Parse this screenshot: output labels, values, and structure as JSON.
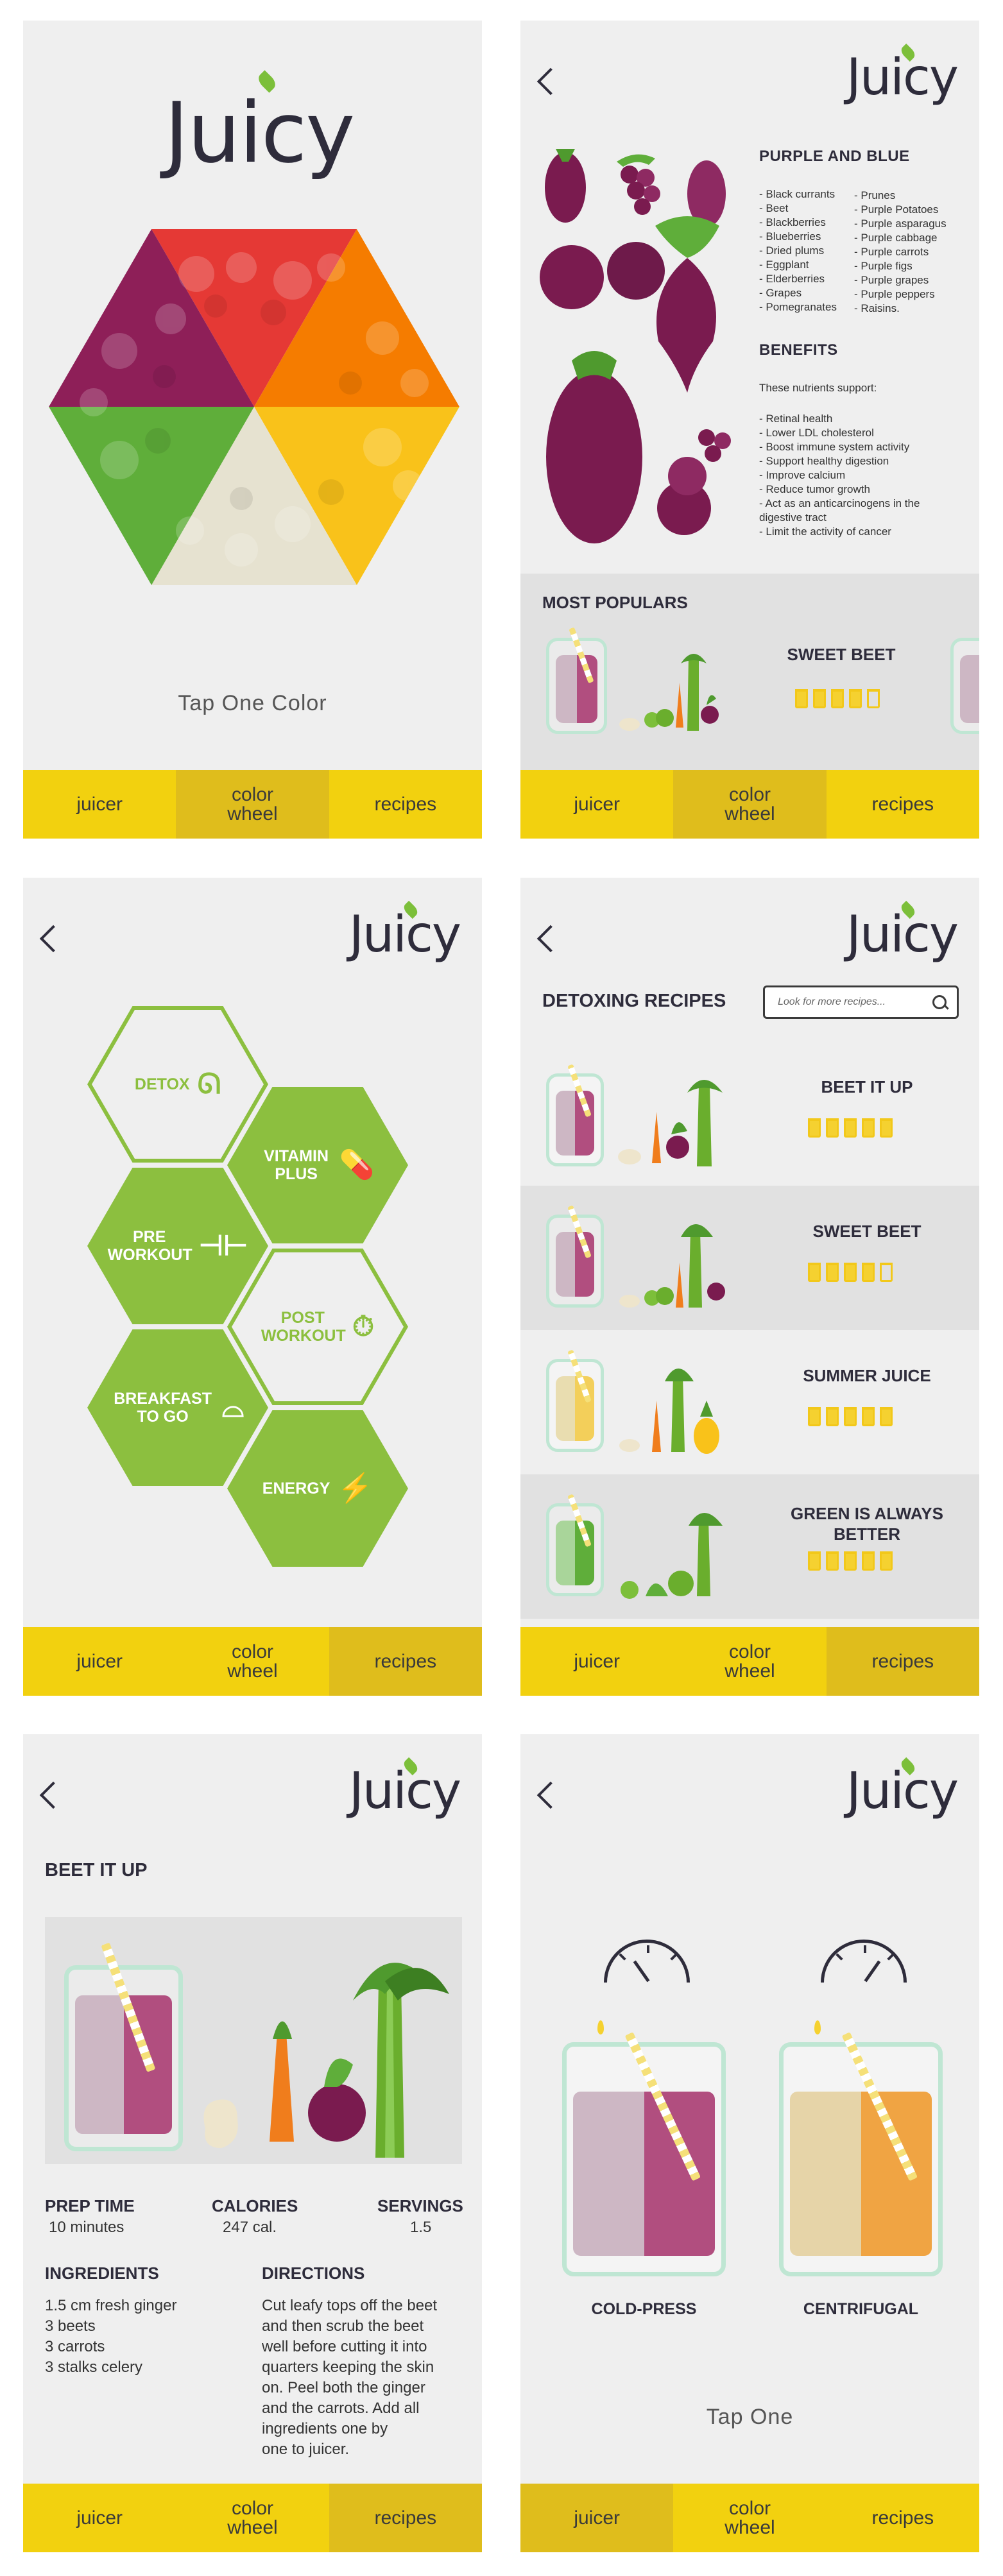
{
  "brand": {
    "logo_text": "Juicy"
  },
  "nav": {
    "juicer": "juicer",
    "color_wheel": "color\nwheel",
    "recipes": "recipes"
  },
  "screen1": {
    "tap_text": "Tap One Color"
  },
  "screen2": {
    "category_title": "PURPLE AND BLUE",
    "foods_col1": [
      "- Black currants",
      "- Beet",
      "- Blackberries",
      "- Blueberries",
      "- Dried plums",
      "- Eggplant",
      "- Elderberries",
      "- Grapes",
      "- Pomegranates"
    ],
    "foods_col2": [
      "- Prunes",
      "- Purple Potatoes",
      "- Purple asparagus",
      "- Purple cabbage",
      "- Purple carrots",
      "- Purple figs",
      "- Purple grapes",
      "- Purple peppers",
      "- Raisins."
    ],
    "benefits_title": "BENEFITS",
    "benefits_intro": "These nutrients support:",
    "benefits": [
      "- Retinal health",
      "- Lower LDL cholesterol",
      "- Boost immune system activity",
      "- Support healthy digestion",
      "- Improve calcium",
      "- Reduce tumor growth",
      "- Act as an anticarcinogens in the digestive tract",
      "- Limit the activity of cancer"
    ],
    "popular_title": "MOST POPULARS",
    "popular_name": "SWEET BEET",
    "popular_rating": 4
  },
  "screen3": {
    "categories": [
      {
        "label": "DETOX",
        "icon": "stomach-icon"
      },
      {
        "label": "VITAMIN PLUS",
        "icon": "pill-icon"
      },
      {
        "label": "PRE WORKOUT",
        "icon": "dumbbell-icon"
      },
      {
        "label": "POST WORKOUT",
        "icon": "stopwatch-icon"
      },
      {
        "label": "BREAKFAST TO GO",
        "icon": "cloche-icon"
      },
      {
        "label": "ENERGY",
        "icon": "lightning-icon"
      }
    ]
  },
  "screen4": {
    "title": "DETOXING RECIPES",
    "search_placeholder": "Look for more recipes...",
    "recipes": [
      {
        "name": "BEET IT UP",
        "rating": 5
      },
      {
        "name": "SWEET BEET",
        "rating": 4
      },
      {
        "name": "SUMMER JUICE",
        "rating": 5
      },
      {
        "name": "GREEN IS ALWAYS BETTER",
        "rating": 5
      }
    ]
  },
  "screen5": {
    "title": "BEET IT UP",
    "prep_label": "PREP TIME",
    "prep_value": "10 minutes",
    "cal_label": "CALORIES",
    "cal_value": "247 cal.",
    "serv_label": "SERVINGS",
    "serv_value": "1.5",
    "ingredients_label": "INGREDIENTS",
    "ingredients": [
      "1.5 cm fresh ginger",
      "3 beets",
      "3 carrots",
      "3 stalks celery"
    ],
    "directions_label": "DIRECTIONS",
    "directions": [
      "Cut leafy tops off the beet",
      "and then scrub the beet",
      "well before cutting it into",
      "quarters keeping the skin",
      "on. Peel both the ginger",
      "and the carrots. Add all",
      "ingredients one by",
      "one to juicer."
    ]
  },
  "screen6": {
    "option1": "COLD-PRESS",
    "option2": "CENTRIFUGAL",
    "tap_text": "Tap One"
  },
  "colors": {
    "accent_yellow": "#f2d10f",
    "active_tab": "#dfbd1c",
    "green": "#8cbf3f",
    "glass": "#bfe6d3"
  }
}
